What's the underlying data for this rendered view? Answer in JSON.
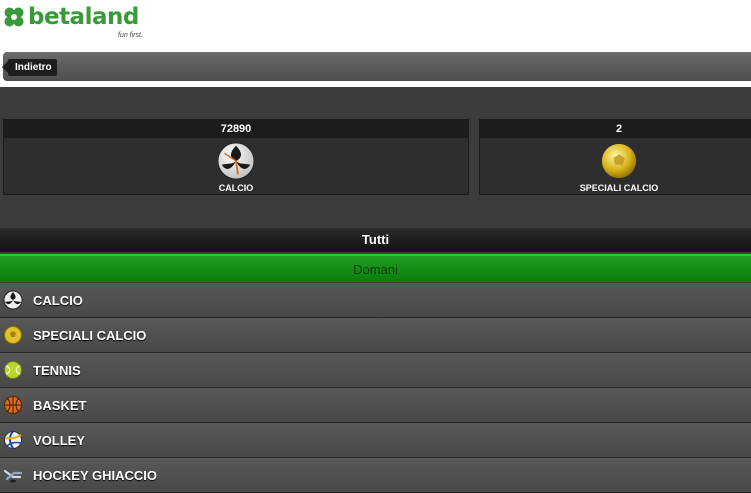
{
  "brand": {
    "name": "betaland",
    "tagline": "fun first."
  },
  "nav": {
    "back_label": "Indietro"
  },
  "cards": [
    {
      "count": "72890",
      "label": "CALCIO",
      "icon": "soccer-ball-icon"
    },
    {
      "count": "2",
      "label": "SPECIALI CALCIO",
      "icon": "golden-ball-icon"
    }
  ],
  "filters": {
    "all_label": "Tutti",
    "tomorrow_label": "Domani"
  },
  "sports": [
    {
      "label": "CALCIO",
      "icon": "soccer-ball-icon"
    },
    {
      "label": "SPECIALI CALCIO",
      "icon": "golden-ball-icon"
    },
    {
      "label": "TENNIS",
      "icon": "tennis-ball-icon"
    },
    {
      "label": "BASKET",
      "icon": "basketball-icon"
    },
    {
      "label": "VOLLEY",
      "icon": "volleyball-icon"
    },
    {
      "label": "HOCKEY GHIACCIO",
      "icon": "ice-hockey-icon"
    }
  ],
  "colors": {
    "brand_green": "#3a9a3a",
    "filter_green": "#0c8c0c",
    "panel_dark": "#3c3c3c"
  }
}
